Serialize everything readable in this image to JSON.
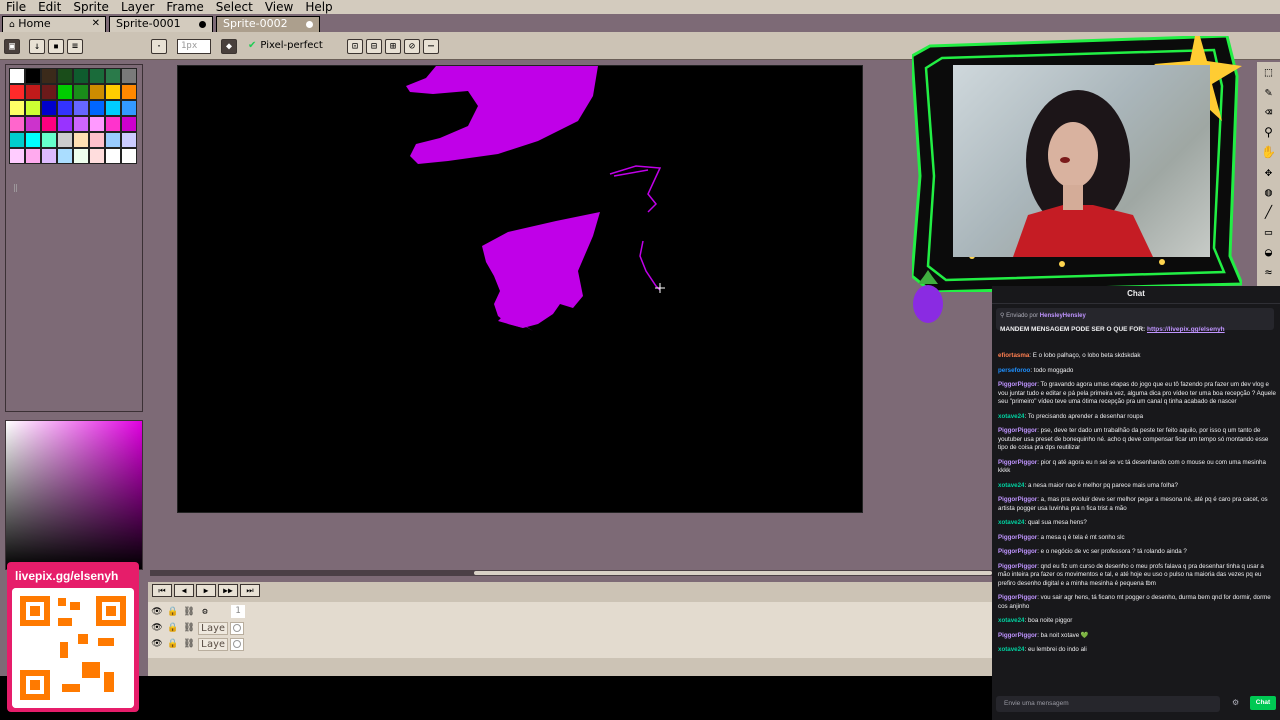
{
  "menu": [
    "File",
    "Edit",
    "Sprite",
    "Layer",
    "Frame",
    "Select",
    "View",
    "Help"
  ],
  "tabs": [
    {
      "label": "Home",
      "icon": "home-icon"
    },
    {
      "label": "Sprite-0001"
    },
    {
      "label": "Sprite-0002"
    }
  ],
  "toolbar": {
    "brush_size_placeholder": "1px",
    "pixel_perfect_label": "Pixel-perfect"
  },
  "palette": {
    "colors": [
      "#ffffff",
      "#000000",
      "#3b2a1a",
      "#1a4d1a",
      "#0f5c2e",
      "#1a6b3a",
      "#2a7a4a",
      "#7a7a7a",
      "#ff2a2a",
      "#c01a1a",
      "#6b1a1a",
      "#00cc00",
      "#1a8c1a",
      "#cc8c00",
      "#ffcc00",
      "#ff8800",
      "#ffff66",
      "#ccff33",
      "#0000cc",
      "#3333ff",
      "#6666ff",
      "#0066ff",
      "#00ccff",
      "#3399ff",
      "#ff66cc",
      "#cc33cc",
      "#ff0080",
      "#9933ff",
      "#cc66ff",
      "#ff99ff",
      "#ff33cc",
      "#cc00cc",
      "#00cccc",
      "#00ffff",
      "#66ffcc",
      "#cccccc",
      "#ffe0b3",
      "#ffc0cb",
      "#99ccff",
      "#ccccff",
      "#ffccff",
      "#ffaaee",
      "#ddbbff",
      "#aaddff",
      "#eeffee",
      "#ffdddd",
      "#ffffff",
      "#ffffff"
    ]
  },
  "timeline": {
    "frame_number": "1",
    "layers": [
      "Laye",
      "Laye",
      "Laye"
    ]
  },
  "chat": {
    "title": "Chat",
    "pinned_prefix": "Enviado por",
    "pinned_user": "HensleyHensley",
    "pinned_text": "MANDEM MENSAGEM PODE SER O QUE FOR:",
    "pinned_link": "https://livepix.gg/elsenyh",
    "messages": [
      {
        "user": "efiortasma",
        "text": "E o lobo palhaço, o lobo beta skdskdak",
        "color": "#ff7f50"
      },
      {
        "user": "perseforoo",
        "text": "todo moggado",
        "color": "#1e90ff"
      },
      {
        "user": "PiggorPiggor",
        "text": "To gravando agora umas etapas do jogo que eu tô fazendo pra fazer um dev vlog e vou juntar tudo e editar e pá pela primeira vez, alguma dica pro vídeo ter uma boa recepção ? Aquele seu \"primeiro\" vídeo teve uma ótima recepção pra um canal q tinha acabado de nascer",
        "color": "#bf94ff"
      },
      {
        "user": "xotave24",
        "text": "To precisando aprender a desenhar roupa",
        "color": "#00d1a0"
      },
      {
        "user": "PiggorPiggor",
        "text": "pse, deve ter dado um trabalhão da peste ter feito aquilo, por isso q um tanto de youtuber usa preset de bonequinho né. acho q deve compensar ficar um tempo só montando esse tipo de coisa pra dps reutilizar",
        "color": "#bf94ff"
      },
      {
        "user": "PiggorPiggor",
        "text": "pior q até agora eu n sei se vc tá desenhando com o mouse ou com uma mesinha kkkk",
        "color": "#bf94ff"
      },
      {
        "user": "xotave24",
        "text": "a nesa maior nao é melhor pq parece mais uma folha?",
        "color": "#00d1a0"
      },
      {
        "user": "PiggorPiggor",
        "text": "a, mas pra evoluir deve ser melhor pegar a mesona né, até pq é caro pra cacet, os artista pogger usa luvinha pra n fica trist a mão",
        "color": "#bf94ff"
      },
      {
        "user": "xotave24",
        "text": "qual sua mesa hens?",
        "color": "#00d1a0"
      },
      {
        "user": "PiggorPiggor",
        "text": "a mesa q é tela é mt sonho slc",
        "color": "#bf94ff"
      },
      {
        "user": "PiggorPiggor",
        "text": "e o negócio de vc ser professora ? tá rolando ainda ?",
        "color": "#bf94ff"
      },
      {
        "user": "PiggorPiggor",
        "text": "qnd eu fiz um curso de desenho o meu profs falava q pra desenhar tinha q usar a mão inteira pra fazer os movimentos e tal, e até hoje eu uso o pulso na maioria das vezes pq eu prefiro desenho digital e a minha mesinha é pequena tbm",
        "color": "#bf94ff"
      },
      {
        "user": "PiggorPiggor",
        "text": "vou sair agr hens, tá ficano mt pogger o desenho, durma bem qnd for dormir, dorme cos anjinho",
        "color": "#bf94ff"
      },
      {
        "user": "xotave24",
        "text": "boa noite piggor",
        "color": "#00d1a0"
      },
      {
        "user": "PiggorPiggor",
        "text": "ba noit xotave 💚",
        "color": "#bf94ff"
      },
      {
        "user": "xotave24",
        "text": "eu lembrei do indo ali",
        "color": "#00d1a0"
      }
    ],
    "input_placeholder": "Envie uma mensagem",
    "send_label": "Chat"
  },
  "livepix": {
    "label": "livepix.gg/elsenyh"
  },
  "colors": {
    "accent_magenta": "#c000e8",
    "workspace_bg": "#7d6a76",
    "chrome": "#ccc3b5",
    "chat_bg": "#18181b"
  }
}
